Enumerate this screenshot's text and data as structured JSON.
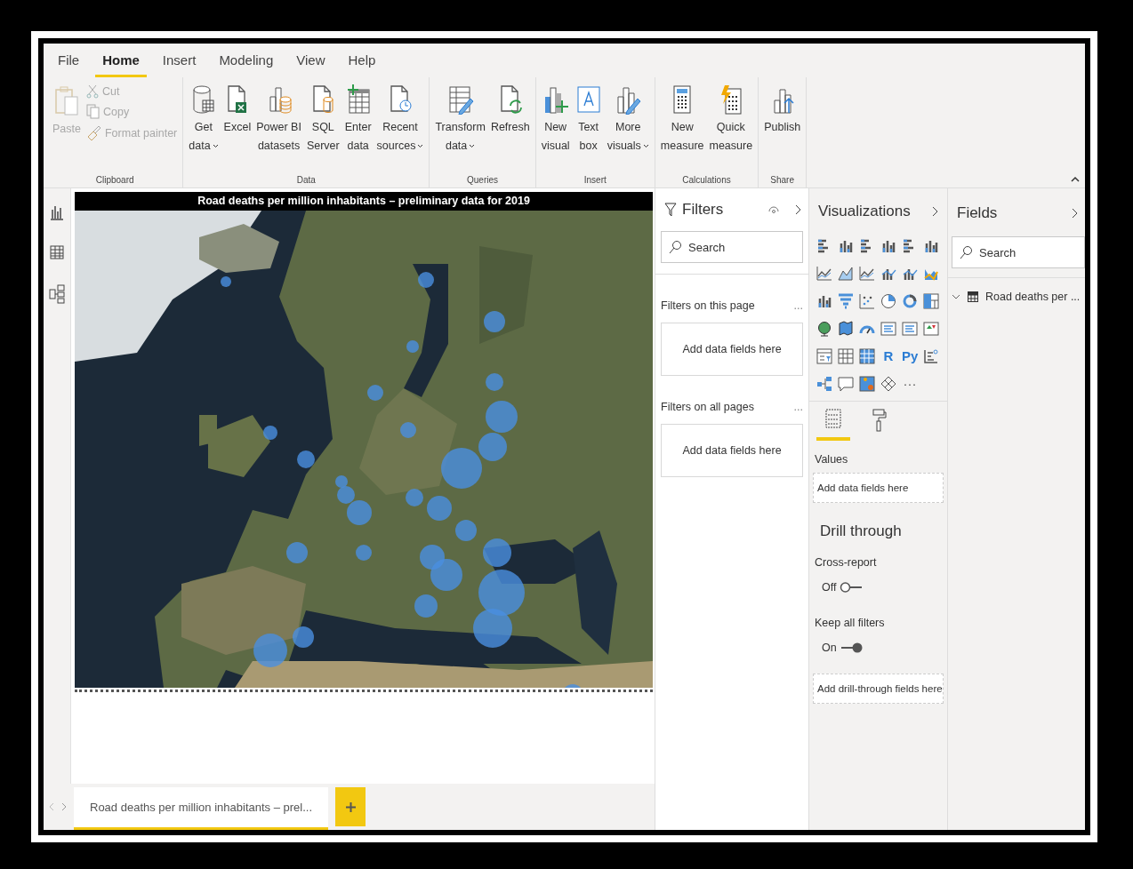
{
  "ribbon": {
    "tabs": [
      {
        "label": "File",
        "selected": false
      },
      {
        "label": "Home",
        "selected": true
      },
      {
        "label": "Insert",
        "selected": false
      },
      {
        "label": "Modeling",
        "selected": false
      },
      {
        "label": "View",
        "selected": false
      },
      {
        "label": "Help",
        "selected": false
      }
    ],
    "groups": [
      {
        "kind": "clipboard",
        "label": "Clipboard",
        "buttons": [
          {
            "lines": [
              "Paste"
            ],
            "disabled": true
          },
          {
            "lines": [
              "Cut"
            ],
            "disabled": true
          },
          {
            "lines": [
              "Copy"
            ],
            "disabled": true
          },
          {
            "lines": [
              "Format painter"
            ],
            "disabled": true
          }
        ]
      },
      {
        "kind": "large",
        "label": "Data",
        "buttons": [
          {
            "lines": [
              "Get",
              "data"
            ],
            "menu": true
          },
          {
            "lines": [
              "Excel"
            ],
            "menu": false
          },
          {
            "lines": [
              "Power BI",
              "datasets"
            ],
            "menu": false
          },
          {
            "lines": [
              "SQL",
              "Server"
            ],
            "menu": false
          },
          {
            "lines": [
              "Enter",
              "data"
            ],
            "menu": false
          },
          {
            "lines": [
              "Recent",
              "sources"
            ],
            "menu": true
          }
        ]
      },
      {
        "kind": "large",
        "label": "Queries",
        "buttons": [
          {
            "lines": [
              "Transform",
              "data"
            ],
            "menu": true
          },
          {
            "lines": [
              "Refresh"
            ],
            "menu": false
          }
        ]
      },
      {
        "kind": "large",
        "label": "Insert",
        "buttons": [
          {
            "lines": [
              "New",
              "visual"
            ],
            "menu": false
          },
          {
            "lines": [
              "Text",
              "box"
            ],
            "menu": false
          },
          {
            "lines": [
              "More",
              "visuals"
            ],
            "menu": true
          }
        ]
      },
      {
        "kind": "large",
        "label": "Calculations",
        "buttons": [
          {
            "lines": [
              "New",
              "measure"
            ],
            "menu": false
          },
          {
            "lines": [
              "Quick",
              "measure"
            ],
            "menu": false
          }
        ]
      },
      {
        "kind": "large",
        "label": "Share",
        "buttons": [
          {
            "lines": [
              "Publish"
            ],
            "menu": false
          }
        ]
      }
    ]
  },
  "report": {
    "visual_title": "Road deaths per million inhabitants – preliminary data for 2019",
    "page_tabs": [
      {
        "label": "Road deaths per million inhabitants – prel...",
        "selected": true
      }
    ]
  },
  "filters": {
    "title": "Filters",
    "search": {
      "placeholder": "Search"
    },
    "sections": [
      {
        "label": "Filters on this page",
        "more": "...",
        "drop": "Add data fields here"
      },
      {
        "label": "Filters on all pages",
        "more": "...",
        "drop": "Add data fields here"
      }
    ]
  },
  "visualizations": {
    "title": "Visualizations",
    "gallery_texts": [
      "R",
      "Py",
      "···"
    ],
    "pane_tabs": [
      {
        "kind": "fields",
        "selected": true
      },
      {
        "kind": "format",
        "selected": false
      }
    ],
    "values_label": "Values",
    "values_drop": "Add data fields here",
    "drill_title": "Drill through",
    "toggles": [
      {
        "label": "Cross-report",
        "state_text": "Off",
        "on": false
      },
      {
        "label": "Keep all filters",
        "state_text": "On",
        "on": true
      }
    ],
    "drill_drop": "Add drill-through fields here"
  },
  "fields": {
    "title": "Fields",
    "search": {
      "placeholder": "Search"
    },
    "tables": [
      {
        "name": "Road deaths per ..."
      }
    ]
  }
}
